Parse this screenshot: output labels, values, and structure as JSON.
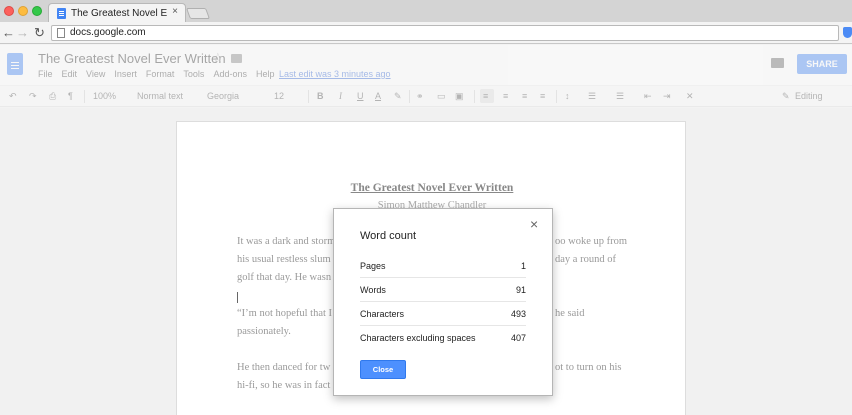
{
  "browser": {
    "tab_title": "The Greatest Novel Ever Written",
    "tab_close": "×",
    "url": "docs.google.com"
  },
  "docs": {
    "title": "The Greatest Novel Ever Written",
    "menu": [
      "File",
      "Edit",
      "View",
      "Insert",
      "Format",
      "Tools",
      "Add-ons",
      "Help"
    ],
    "last_edit": "Last edit was 3 minutes ago",
    "share_label": "SHARE",
    "toolbar": {
      "zoom": "100%",
      "style": "Normal text",
      "font": "Georgia",
      "size": "12",
      "bold": "B",
      "italic": "I",
      "underline": "U",
      "text_color": "A",
      "mode": "Editing"
    }
  },
  "document": {
    "heading": "The Greatest Novel Ever Written",
    "author": "Simon Matthew Chandler",
    "lines": [
      "It was a dark and storm",
      "his usual restless slum",
      "golf that day. He wasn",
      "“I’m not hopeful that I",
      "passionately.",
      "He then danced for tw",
      "hi-fi, so he was in fact"
    ],
    "lines_right": [
      "oo woke up from",
      "day a round of",
      "he said",
      "ot to turn on his"
    ]
  },
  "dialog": {
    "title": "Word count",
    "close_x": "×",
    "rows": [
      {
        "label": "Pages",
        "value": "1"
      },
      {
        "label": "Words",
        "value": "91"
      },
      {
        "label": "Characters",
        "value": "493"
      },
      {
        "label": "Characters excluding spaces",
        "value": "407"
      }
    ],
    "close_label": "Close"
  }
}
